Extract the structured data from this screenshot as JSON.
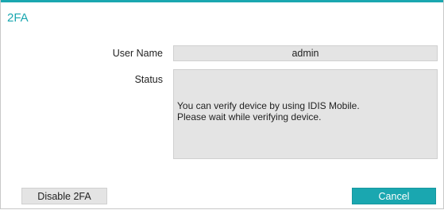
{
  "dialog": {
    "title": "2FA"
  },
  "form": {
    "user_name_label": "User Name",
    "user_name_value": "admin",
    "status_label": "Status",
    "status_lines": [
      "You can verify device by using IDIS Mobile.",
      "Please wait while verifying device."
    ]
  },
  "buttons": {
    "disable_label": "Disable 2FA",
    "cancel_label": "Cancel"
  },
  "colors": {
    "accent": "#1aa7b0",
    "field_bg": "#e4e4e4"
  }
}
